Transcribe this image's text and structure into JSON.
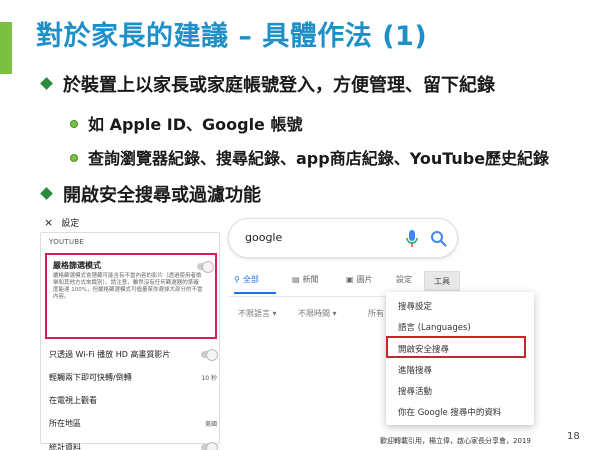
{
  "title": "對於家長的建議 – 具體作法 (1)",
  "bullets": {
    "b1": "於裝置上以家長或家庭帳號登入，方便管理、留下紀錄",
    "b2": "如 Apple ID、Google 帳號",
    "b3": "查詢瀏覽器紀錄、搜尋紀錄、app商店紀錄、YouTube歷史紀錄",
    "b4": "開啟安全搜尋或過濾功能"
  },
  "settings": {
    "close": "×",
    "title": "設定",
    "section": "YOUTUBE",
    "restricted_title": "嚴格篩選模式",
    "restricted_desc": "嚴格篩選模式會隱藏可能含有不當內容的影片（透過使用者檢舉和其他方式來識別）。請注意，雖然沒有任何篩選器的準確度能達 100%，但嚴格篩選模式可儘量幫你避掉大部分的不當內容。",
    "rows": [
      {
        "label": "只透過 Wi-Fi 播放 HD 高畫質影片",
        "value": ""
      },
      {
        "label": "輕觸兩下即可快轉/倒轉",
        "value": "10 秒"
      },
      {
        "label": "在電視上觀看",
        "value": ""
      },
      {
        "label": "所在地區",
        "value": "美國"
      },
      {
        "label": "統計資料",
        "value": ""
      }
    ]
  },
  "google": {
    "query": "google",
    "tabs": {
      "all": "全部",
      "news": "新聞",
      "images": "圖片",
      "settings": "設定",
      "tools": "工具"
    },
    "filters": [
      "不限語言 ▾",
      "不限時間 ▾",
      "所有"
    ],
    "menu": [
      "搜尋設定",
      "語言 (Languages)",
      "開啟安全搜尋",
      "進階搜尋",
      "搜尋活動",
      "你在 Google 搜尋中的資料"
    ]
  },
  "footer": "歡迎轉載引用，楊立偉，啟心家長分享會，2019",
  "page_number": "18",
  "colors": {
    "title": "#1f8fc8",
    "accent": "#7ac143",
    "highlight_pink": "#d81b60",
    "highlight_red": "#c62828",
    "google_blue": "#1a73e8"
  }
}
